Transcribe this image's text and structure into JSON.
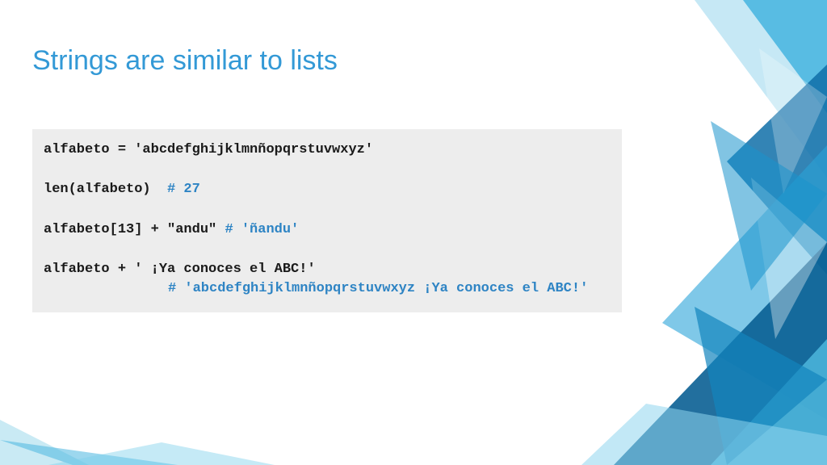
{
  "title": "Strings are similar to lists",
  "code": {
    "line1": "alfabeto = 'abcdefghijklmnñopqrstuvwxyz'",
    "line2_code": "len(alfabeto)  ",
    "line2_comment": "# 27",
    "line3_code": "alfabeto[13] + \"andu\" ",
    "line3_comment": "# 'ñandu'",
    "line4": "alfabeto + ' ¡Ya conoces el ABC!'",
    "line5_comment": "# 'abcdefghijklmnñopqrstuvwxyz ¡Ya conoces el ABC!'"
  },
  "colors": {
    "accent": "#3399d6",
    "comment": "#2e84c4",
    "codebg": "#ededed"
  }
}
